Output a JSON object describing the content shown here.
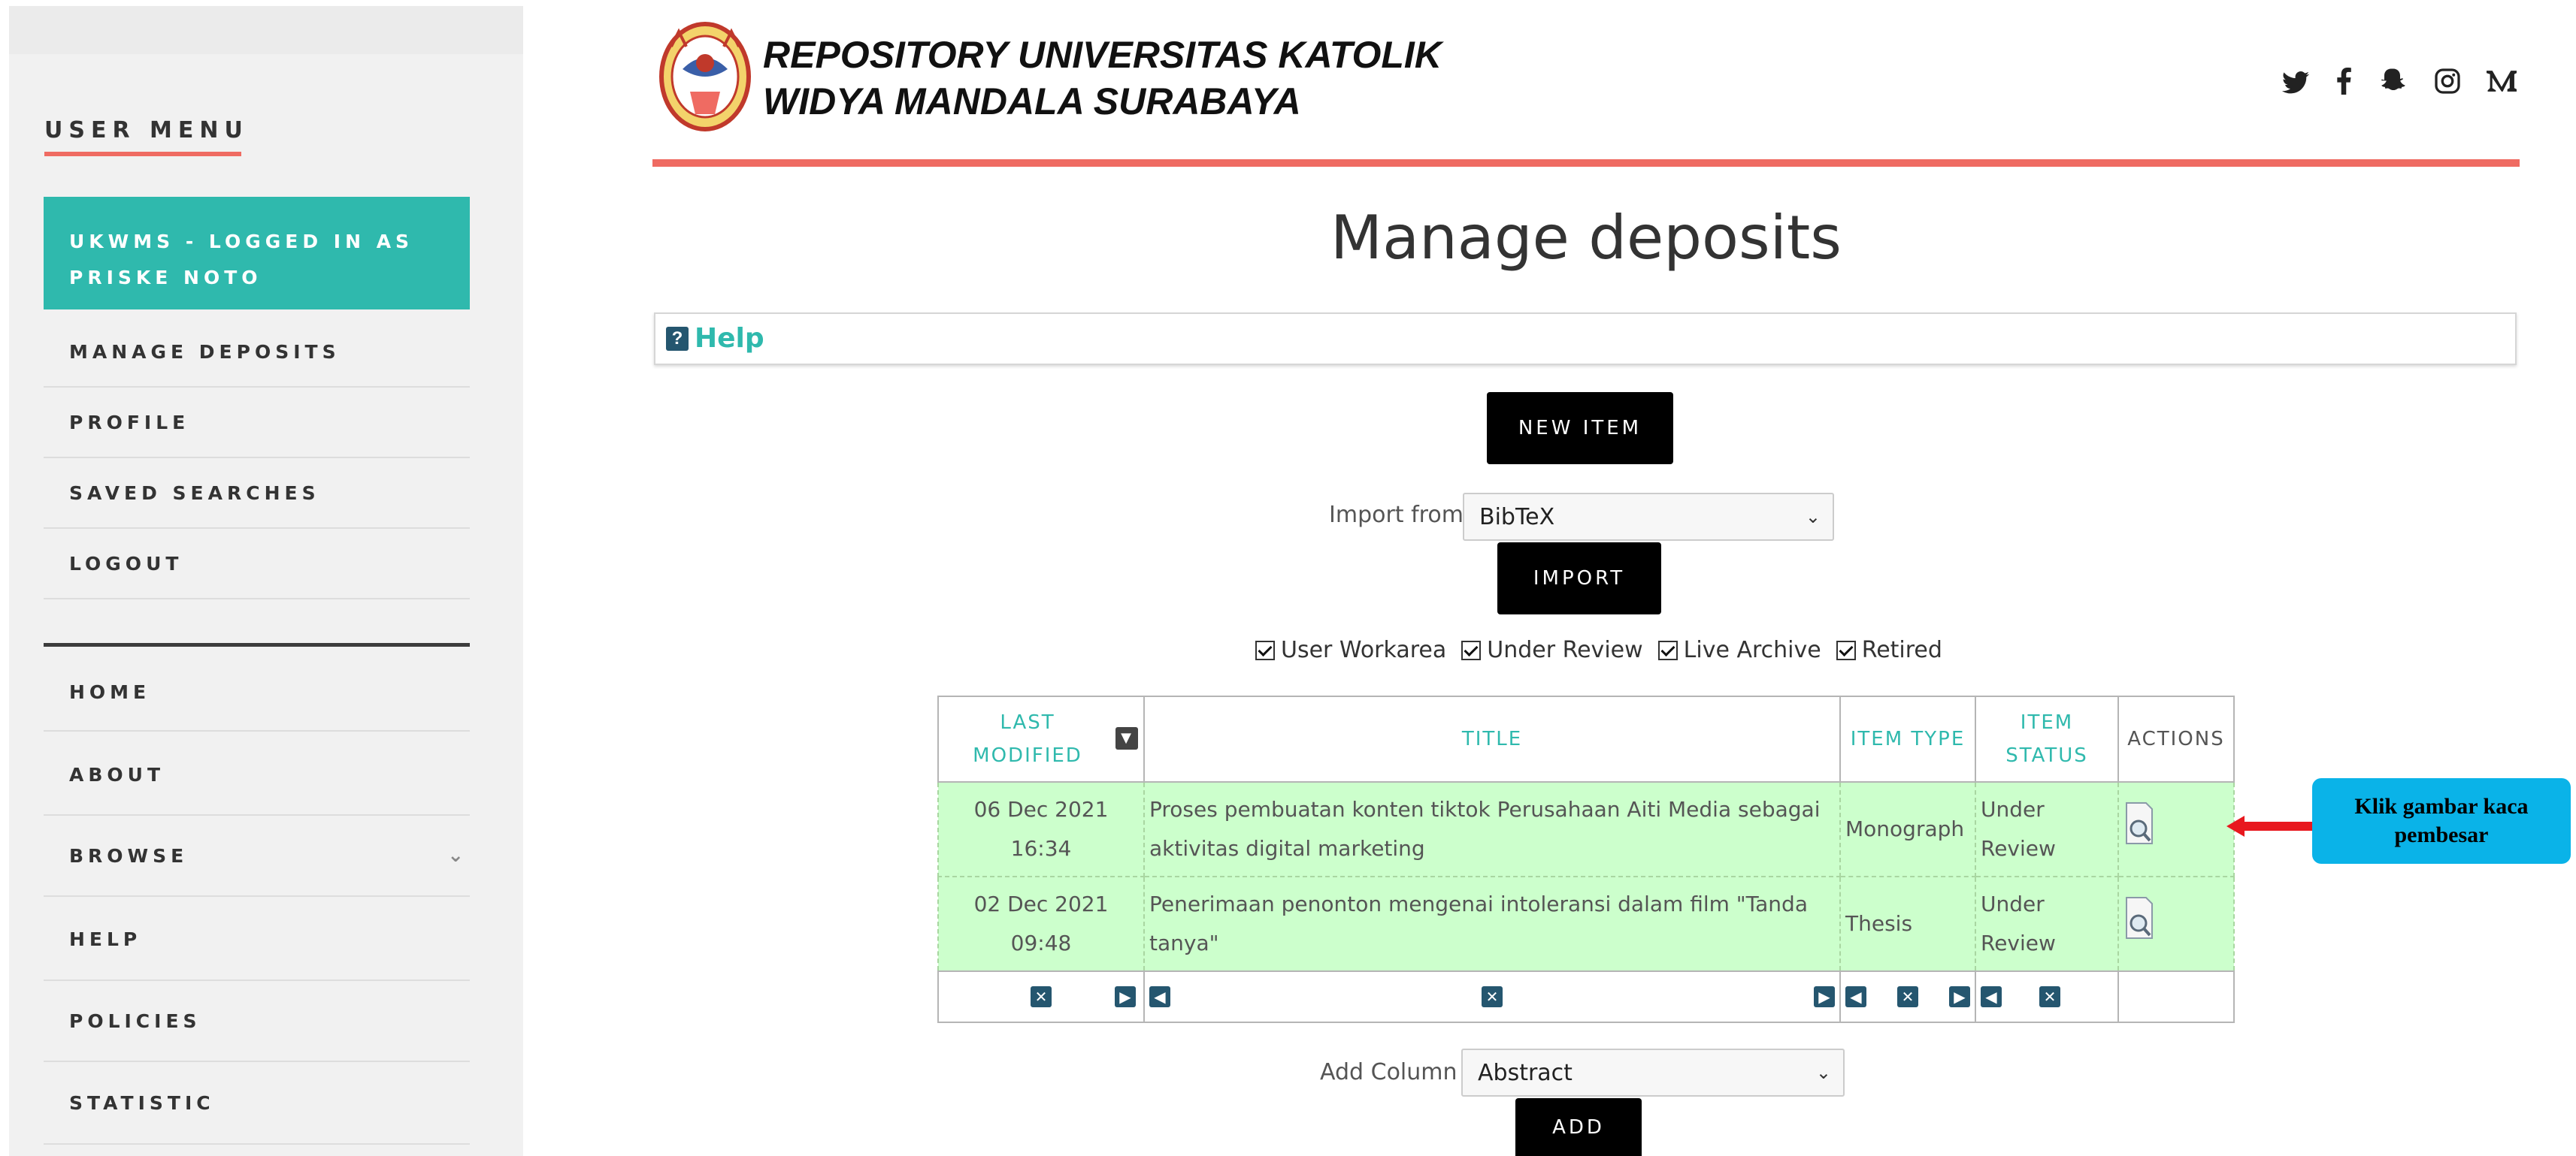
{
  "sidebar": {
    "title": "USER MENU",
    "logged_in": "UKWMS - LOGGED IN AS PRISKE NOTO",
    "user_items": [
      "MANAGE DEPOSITS",
      "PROFILE",
      "SAVED SEARCHES",
      "LOGOUT"
    ],
    "nav_items": [
      "HOME",
      "ABOUT",
      "BROWSE",
      "HELP",
      "POLICIES",
      "STATISTIC"
    ]
  },
  "header": {
    "brand_line1": "REPOSITORY UNIVERSITAS KATOLIK",
    "brand_line2": "WIDYA MANDALA SURABAYA",
    "social_icons": [
      "twitter-icon",
      "facebook-icon",
      "snapchat-icon",
      "instagram-icon",
      "medium-icon"
    ]
  },
  "main": {
    "title": "Manage deposits",
    "help_label": "Help",
    "new_item_label": "NEW ITEM",
    "import_from_label": "Import from",
    "import_select_value": "BibTeX",
    "import_label": "IMPORT",
    "filters": [
      {
        "label": "User Workarea",
        "checked": true
      },
      {
        "label": "Under Review",
        "checked": true
      },
      {
        "label": "Live Archive",
        "checked": true
      },
      {
        "label": "Retired",
        "checked": true
      }
    ],
    "add_column_label": "Add Column",
    "add_column_value": "Abstract",
    "add_label": "ADD"
  },
  "table": {
    "headers": [
      "LAST MODIFIED",
      "TITLE",
      "ITEM TYPE",
      "ITEM STATUS",
      "ACTIONS"
    ],
    "rows": [
      {
        "modified": "06 Dec 2021 16:34",
        "title": "Proses pembuatan konten tiktok Perusahaan Aiti Media sebagai aktivitas digital marketing",
        "type": "Monograph",
        "status": "Under Review"
      },
      {
        "modified": "02 Dec 2021 09:48",
        "title": "Penerimaan penonton mengenai intoleransi dalam film \"Tanda tanya\"",
        "type": "Thesis",
        "status": "Under Review"
      }
    ]
  },
  "annotation": {
    "callout": "Klik gambar kaca pembesar",
    "color": "#0ab3e8",
    "arrow_color": "#e8181e"
  },
  "colors": {
    "accent": "#2fb9ad",
    "header_line": "#ef6b62",
    "row_bg": "#ccffcc"
  }
}
